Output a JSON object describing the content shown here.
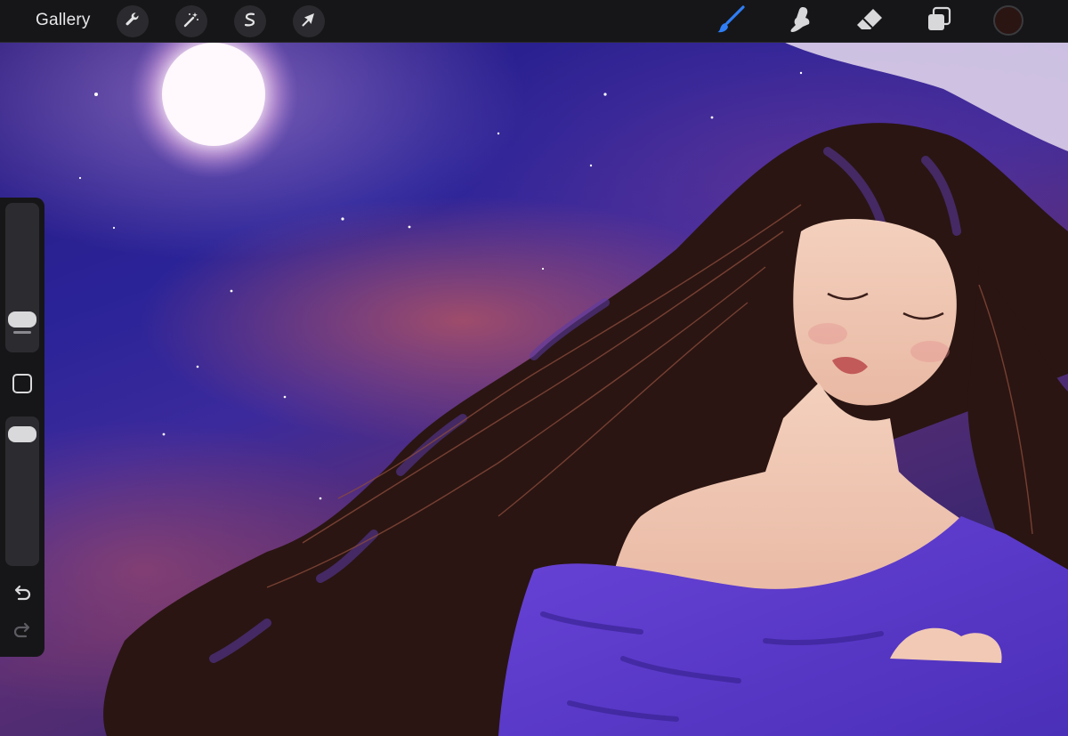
{
  "topbar": {
    "gallery_label": "Gallery",
    "left_tools": [
      "wrench-icon",
      "magic-wand-icon",
      "selection-s-icon",
      "transform-arrow-icon"
    ],
    "right_tools": [
      "brush-icon",
      "smudge-icon",
      "eraser-icon",
      "layers-icon"
    ],
    "active_tool": "brush-icon",
    "active_color": "#2a1512",
    "accent": "#2f7ef5"
  },
  "sidebar": {
    "brush_size_level": 0.12,
    "opacity_level": 0.95,
    "icons": [
      "modify-square-icon",
      "undo-icon",
      "redo-icon"
    ]
  },
  "canvas": {
    "subject": "painting",
    "colors": {
      "sky": "#2a2398",
      "glow": "#b05262",
      "moon": "#fff7fb",
      "hair": "#2a1512",
      "skin": "#f1c9b5",
      "dress": "#5b3ad1"
    }
  }
}
